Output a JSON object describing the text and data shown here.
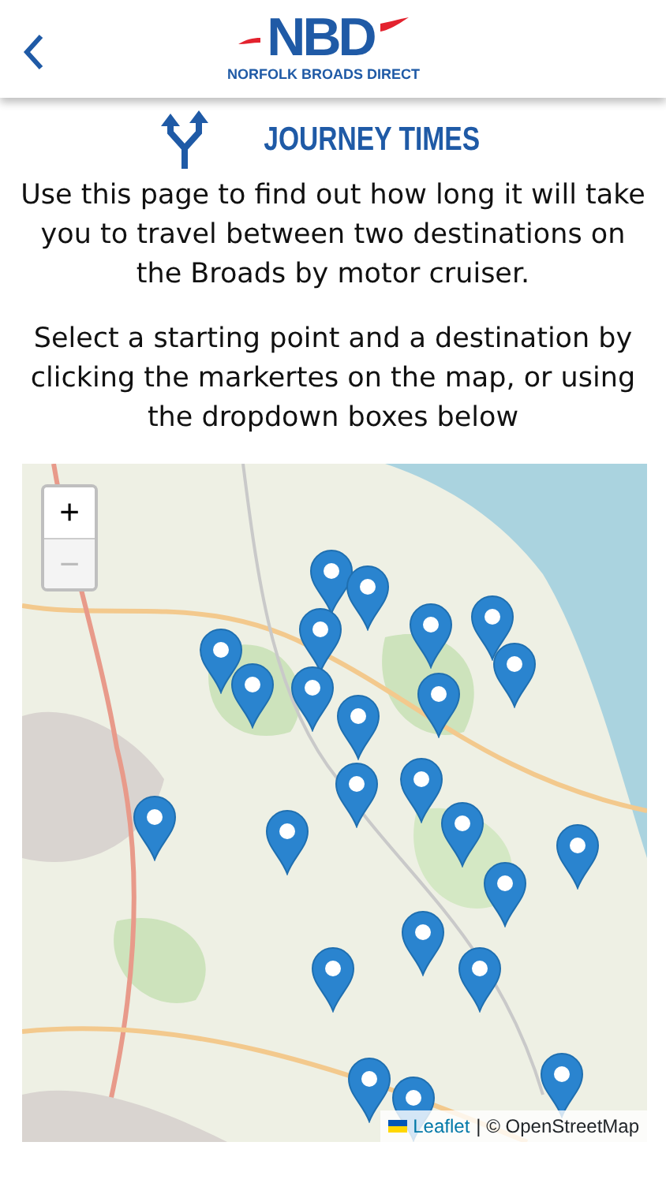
{
  "header": {
    "logo_mark": "NBD",
    "logo_text": "NORFOLK BROADS DIRECT"
  },
  "page": {
    "title": "JOURNEY TIMES",
    "paragraphs": [
      "Use this page to find out how long it will take you to travel between two destinations on the Broads by motor cruiser.",
      "Select a starting point and a destination by clicking the markertes on the map, or using the dropdown boxes below"
    ]
  },
  "map": {
    "zoom_in": "+",
    "zoom_out": "−",
    "zoom_out_disabled": true,
    "attribution_link": "Leaflet",
    "attribution_text": "| © OpenStreetMap"
  }
}
